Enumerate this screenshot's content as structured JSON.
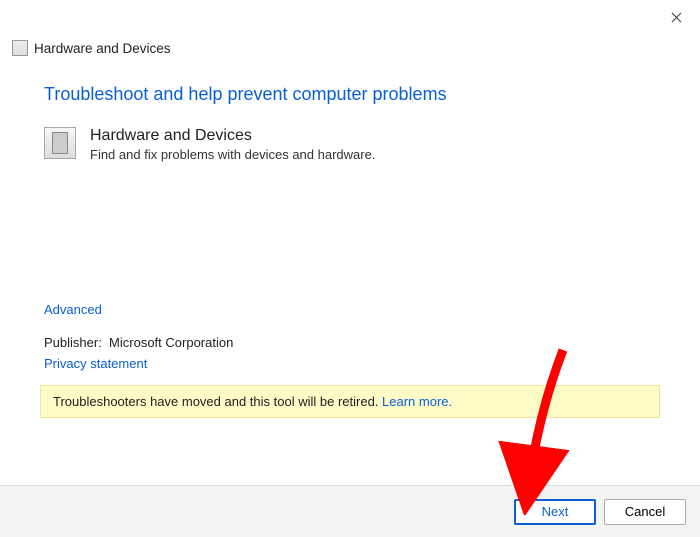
{
  "window": {
    "title": "Hardware and Devices"
  },
  "main": {
    "heading": "Troubleshoot and help prevent computer problems",
    "troubleshooter": {
      "name": "Hardware and Devices",
      "desc": "Find and fix problems with devices and hardware."
    },
    "advanced": "Advanced",
    "publisher_label": "Publisher:",
    "publisher_name": "Microsoft Corporation",
    "privacy": "Privacy statement",
    "notice": {
      "text": "Troubleshooters have moved and this tool will be retired. ",
      "learn": "Learn more."
    }
  },
  "footer": {
    "next": "Next",
    "cancel": "Cancel"
  }
}
